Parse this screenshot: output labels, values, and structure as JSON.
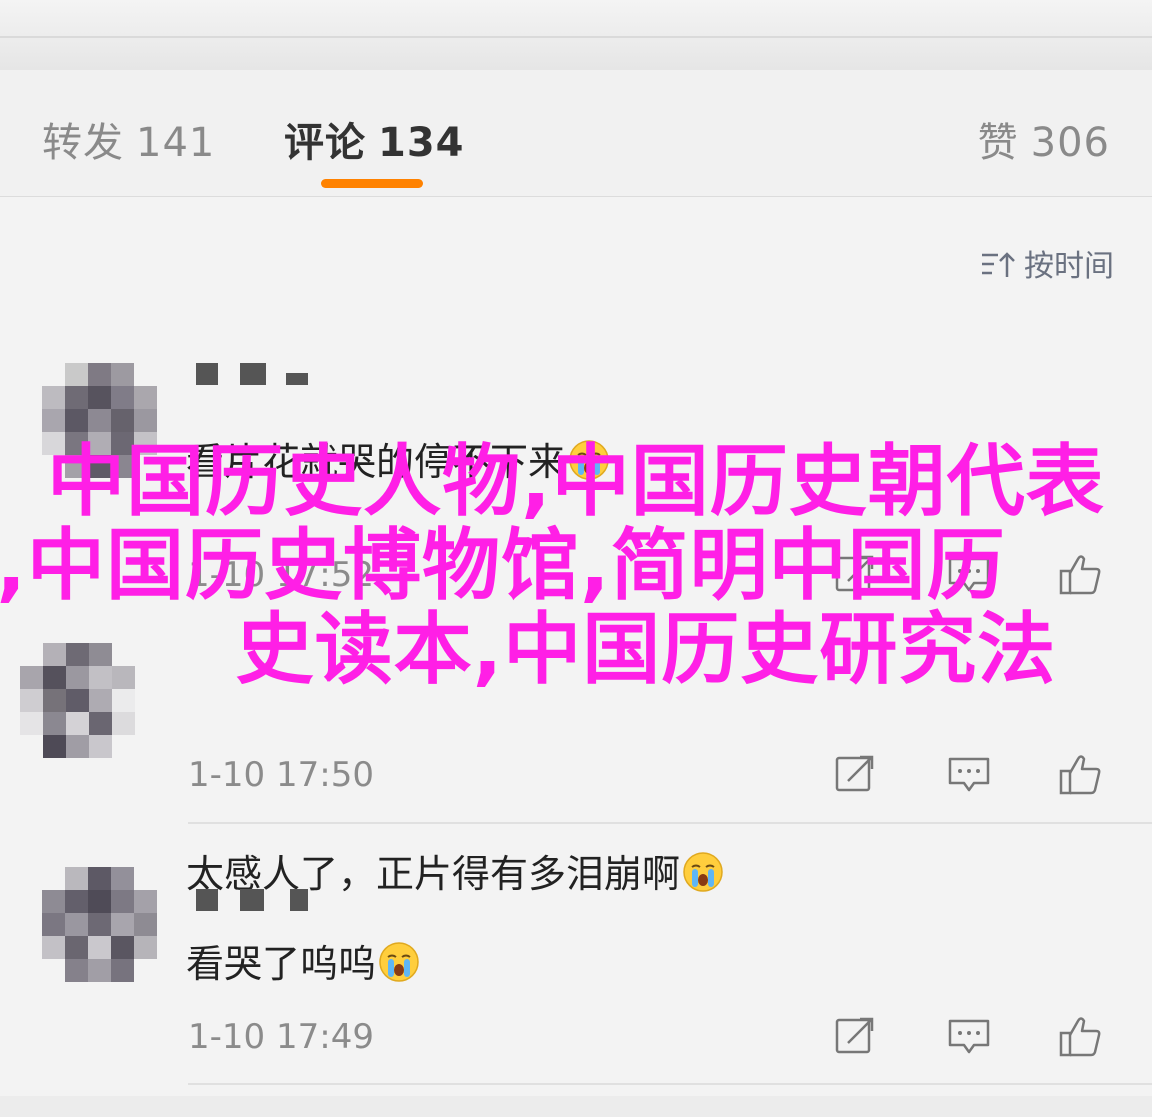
{
  "tabs": [
    {
      "label": "转发",
      "count": "141",
      "active": false
    },
    {
      "label": "评论",
      "count": "134",
      "active": true
    },
    {
      "label": "赞",
      "count": "306",
      "active": false
    }
  ],
  "sort_label": "按时间",
  "comments": [
    {
      "text": "看片花就哭的停不下来",
      "emoji": "crying-emoji",
      "time": "1-10 17:52"
    },
    {
      "text": "太感人了，正片得有多泪崩啊",
      "emoji": "crying-emoji",
      "time": "1-10 17:50"
    },
    {
      "text": "看哭了呜呜",
      "emoji": "crying-emoji",
      "time": "1-10 17:49"
    }
  ],
  "overlay": {
    "line1": "中国历史人物,中国历史朝代表",
    "line2": ",中国历史博物馆,简明中国历",
    "line3": "史读本,中国历史研究法"
  },
  "icons": [
    "sort-icon",
    "share-icon",
    "reply-icon",
    "like-icon",
    "crying-emoji"
  ],
  "colors": {
    "accent": "#ff8200",
    "overlay_text": "#ff1fe6"
  }
}
